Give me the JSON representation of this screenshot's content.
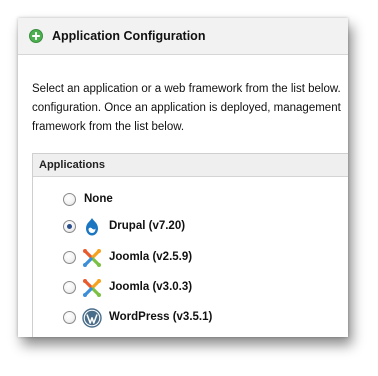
{
  "panel": {
    "title": "Application Configuration",
    "description_lines": [
      "Select an application or a web framework from the list below.",
      "configuration. Once an application is deployed, management",
      "framework from the list below."
    ]
  },
  "applications": {
    "header": "Applications",
    "items": [
      {
        "label": "None",
        "icon": "none",
        "selected": false
      },
      {
        "label": "Drupal (v7.20)",
        "icon": "drupal-icon",
        "selected": true
      },
      {
        "label": "Joomla (v2.5.9)",
        "icon": "joomla-icon",
        "selected": false
      },
      {
        "label": "Joomla (v3.0.3)",
        "icon": "joomla-icon",
        "selected": false
      },
      {
        "label": "WordPress (v3.5.1)",
        "icon": "wordpress-icon",
        "selected": false
      }
    ]
  },
  "colors": {
    "header_icon": "#5cb85c",
    "drupal": "#1b76c2",
    "joomla": [
      "#e85b2d",
      "#f6a21d",
      "#7ac143",
      "#3a8fd8"
    ],
    "wordpress": "#4a6e8a"
  }
}
